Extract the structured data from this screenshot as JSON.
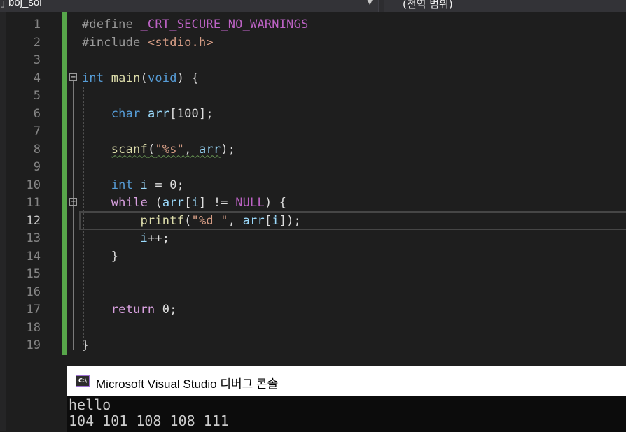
{
  "navbar": {
    "project": "boj_sol",
    "scope": "(전역 범위)"
  },
  "editor": {
    "current_line": 12,
    "line_numbers": [
      "1",
      "2",
      "3",
      "4",
      "5",
      "6",
      "7",
      "8",
      "9",
      "10",
      "11",
      "12",
      "13",
      "14",
      "15",
      "16",
      "17",
      "18",
      "19"
    ],
    "lines": [
      [
        {
          "t": "#define ",
          "c": "pp"
        },
        {
          "t": "_CRT_SECURE_NO_WARNINGS",
          "c": "macro"
        }
      ],
      [
        {
          "t": "#include ",
          "c": "pp"
        },
        {
          "t": "<stdio.h>",
          "c": "str"
        }
      ],
      [],
      [
        {
          "t": "int",
          "c": "kw"
        },
        {
          "t": " ",
          "c": "plain"
        },
        {
          "t": "main",
          "c": "fn"
        },
        {
          "t": "(",
          "c": "plain"
        },
        {
          "t": "void",
          "c": "kw"
        },
        {
          "t": ") {",
          "c": "plain"
        }
      ],
      [],
      [
        {
          "t": "    ",
          "c": "plain"
        },
        {
          "t": "char",
          "c": "kw"
        },
        {
          "t": " ",
          "c": "plain"
        },
        {
          "t": "arr",
          "c": "var"
        },
        {
          "t": "[100];",
          "c": "plain"
        }
      ],
      [],
      [
        {
          "t": "    ",
          "c": "plain"
        },
        {
          "t": "scanf",
          "c": "fn",
          "u": true
        },
        {
          "t": "(",
          "c": "plain",
          "u": true
        },
        {
          "t": "\"%s\"",
          "c": "str",
          "u": true
        },
        {
          "t": ", ",
          "c": "plain",
          "u": true
        },
        {
          "t": "arr",
          "c": "var",
          "u": true
        },
        {
          "t": ");",
          "c": "plain"
        }
      ],
      [],
      [
        {
          "t": "    ",
          "c": "plain"
        },
        {
          "t": "int",
          "c": "kw"
        },
        {
          "t": " ",
          "c": "plain"
        },
        {
          "t": "i",
          "c": "var"
        },
        {
          "t": " = 0;",
          "c": "plain"
        }
      ],
      [
        {
          "t": "    ",
          "c": "plain"
        },
        {
          "t": "while",
          "c": "ctrl"
        },
        {
          "t": " (",
          "c": "plain"
        },
        {
          "t": "arr",
          "c": "var"
        },
        {
          "t": "[",
          "c": "plain"
        },
        {
          "t": "i",
          "c": "var"
        },
        {
          "t": "] != ",
          "c": "plain"
        },
        {
          "t": "NULL",
          "c": "macro"
        },
        {
          "t": ") {",
          "c": "plain"
        }
      ],
      [
        {
          "t": "        ",
          "c": "plain"
        },
        {
          "t": "printf",
          "c": "fn"
        },
        {
          "t": "(",
          "c": "plain"
        },
        {
          "t": "\"%d \"",
          "c": "str"
        },
        {
          "t": ", ",
          "c": "plain"
        },
        {
          "t": "arr",
          "c": "var"
        },
        {
          "t": "[",
          "c": "plain"
        },
        {
          "t": "i",
          "c": "var"
        },
        {
          "t": "]);",
          "c": "plain"
        }
      ],
      [
        {
          "t": "        ",
          "c": "plain"
        },
        {
          "t": "i",
          "c": "var"
        },
        {
          "t": "++;",
          "c": "plain"
        }
      ],
      [
        {
          "t": "    }",
          "c": "plain"
        }
      ],
      [],
      [],
      [
        {
          "t": "    ",
          "c": "plain"
        },
        {
          "t": "return",
          "c": "ctrl"
        },
        {
          "t": " 0;",
          "c": "plain"
        }
      ],
      [],
      [
        {
          "t": "}",
          "c": "plain"
        }
      ]
    ]
  },
  "console": {
    "icon_text": "C:\\",
    "title": "Microsoft Visual Studio 디버그 콘솔",
    "output": [
      "hello",
      "104 101 108 108 111"
    ]
  },
  "colors": {
    "keyword": "#569cd6",
    "control": "#d8a0df",
    "function": "#dcdcaa",
    "variable": "#9cdcfe",
    "string": "#d69d85",
    "macro": "#bd63c5",
    "change_bar": "#57a64a"
  }
}
